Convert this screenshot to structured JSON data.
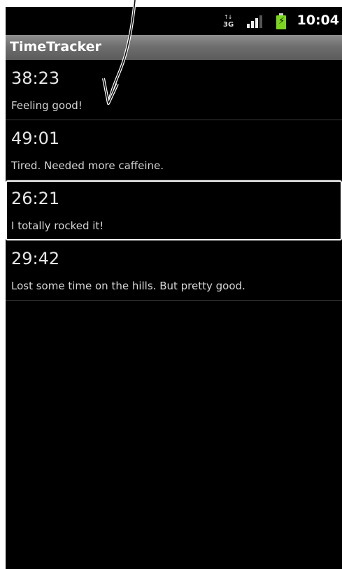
{
  "status_bar": {
    "network_label": "3G",
    "clock": "10:04",
    "icons": [
      "network-3g-icon",
      "signal-strength-icon",
      "battery-charging-icon"
    ],
    "battery_color": "#7bd51f"
  },
  "app": {
    "title": "TimeTracker"
  },
  "entries": [
    {
      "time": "38:23",
      "note": "Feeling good!"
    },
    {
      "time": "49:01",
      "note": "Tired. Needed more caffeine."
    },
    {
      "time": "26:21",
      "note": "I totally rocked it!",
      "selected": true
    },
    {
      "time": "29:42",
      "note": "Lost some time on the hills. But pretty good."
    }
  ],
  "colors": {
    "background": "#000000",
    "title_bar": "#6f6f6f",
    "selection_border": "#ffffff"
  }
}
